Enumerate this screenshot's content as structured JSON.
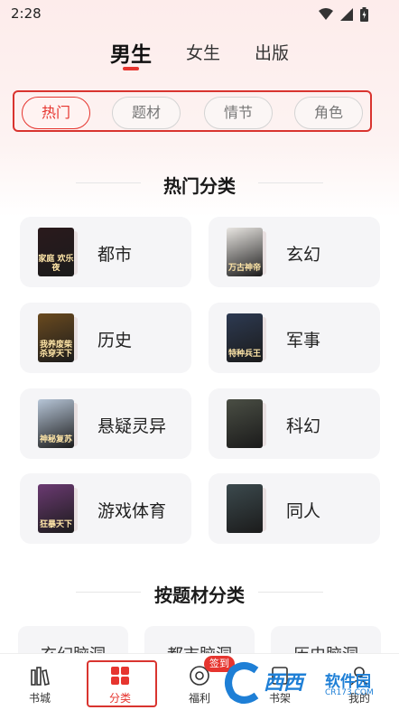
{
  "status_bar": {
    "time": "2:28"
  },
  "gender_tabs": [
    {
      "label": "男生",
      "active": true
    },
    {
      "label": "女生",
      "active": false
    },
    {
      "label": "出版",
      "active": false
    }
  ],
  "filter_chips": [
    {
      "label": "热门",
      "active": true
    },
    {
      "label": "题材",
      "active": false
    },
    {
      "label": "情节",
      "active": false
    },
    {
      "label": "角色",
      "active": false
    }
  ],
  "hot_section": {
    "title": "热门分类",
    "categories": [
      {
        "label": "都市",
        "cover_text": "家庭 欢乐夜",
        "cover_color": "#2a1a1c"
      },
      {
        "label": "玄幻",
        "cover_text": "万古神帝",
        "cover_color": "#e9e6e2"
      },
      {
        "label": "历史",
        "cover_text": "我养废柴 杀穿天下",
        "cover_color": "#6a4a1f"
      },
      {
        "label": "军事",
        "cover_text": "特种兵王",
        "cover_color": "#2d3a52"
      },
      {
        "label": "悬疑灵异",
        "cover_text": "神秘复苏",
        "cover_color": "#b7c6d8"
      },
      {
        "label": "科幻",
        "cover_text": "",
        "cover_color": "#4a4e44"
      },
      {
        "label": "游戏体育",
        "cover_text": "狂暴天下",
        "cover_color": "#6b3a72"
      },
      {
        "label": "同人",
        "cover_text": "",
        "cover_color": "#3c4a4e"
      }
    ]
  },
  "topic_section": {
    "title": "按题材分类",
    "topics": [
      "玄幻脑洞",
      "都市脑洞",
      "历史脑洞"
    ]
  },
  "bottom_nav": {
    "items": [
      {
        "label": "书城",
        "active": false
      },
      {
        "label": "分类",
        "active": true
      },
      {
        "label": "福利",
        "active": false
      },
      {
        "label": "书架",
        "active": false
      },
      {
        "label": "我的",
        "active": false
      }
    ],
    "sign_badge": "签到"
  },
  "watermark": {
    "brand": "西西",
    "name": "软件园",
    "url": "CR173.COM"
  },
  "colors": {
    "accent": "#e6352f",
    "card_bg": "#f5f5f7"
  }
}
